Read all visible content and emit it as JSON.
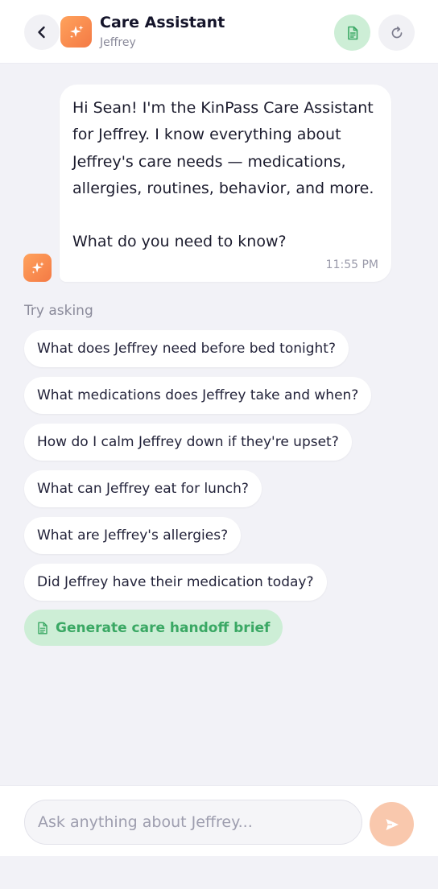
{
  "header": {
    "title": "Care Assistant",
    "subtitle": "Jeffrey",
    "back_icon": "chevron-left-icon",
    "avatar_icon": "sparkles-icon",
    "doc_icon": "document-icon",
    "refresh_icon": "refresh-icon"
  },
  "message": {
    "text": "Hi Sean! I'm the KinPass Care Assistant\nfor Jeffrey. I know everything about\nJeffrey's care needs — medications,\nallergies, routines, behavior, and more.\n\nWhat do you need to know?",
    "time": "11:55 PM"
  },
  "suggestions": {
    "label": "Try asking",
    "items": [
      "What does Jeffrey need before bed tonight?",
      "What medications does Jeffrey take and when?",
      "How do I calm Jeffrey down if they're upset?",
      "What can Jeffrey eat for lunch?",
      "What are Jeffrey's allergies?",
      "Did Jeffrey have their medication today?"
    ],
    "brief_button": "Generate care handoff brief"
  },
  "composer": {
    "placeholder": "Ask anything about Jeffrey...",
    "value": ""
  },
  "colors": {
    "accent_orange": "#f47a45",
    "accent_green": "#3aa864",
    "green_bg": "#cdeed6",
    "background": "#f2f2f7"
  }
}
